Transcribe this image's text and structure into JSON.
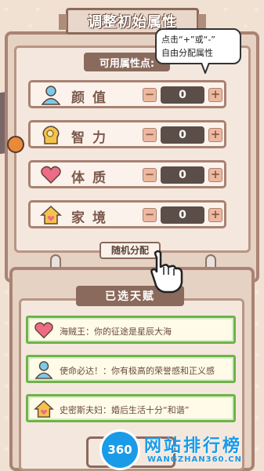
{
  "title": "调整初始属性",
  "available_points_label": "可用属性点:",
  "tooltip": {
    "line1": "点击“+”或“-”",
    "line2": "自由分配属性"
  },
  "attributes": [
    {
      "label": "颜值",
      "icon": "person-icon",
      "value": "0"
    },
    {
      "label": "智力",
      "icon": "brain-icon",
      "value": "0"
    },
    {
      "label": "体质",
      "icon": "heart-icon",
      "value": "0"
    },
    {
      "label": "家境",
      "icon": "house-icon",
      "value": "0"
    }
  ],
  "controls": {
    "minus": "−",
    "plus": "+"
  },
  "random_button": "随机分配",
  "selected_talents_label": "已选天赋",
  "talents": [
    {
      "icon": "heart-icon",
      "text": "海贼王：你的征途是星辰大海"
    },
    {
      "icon": "person-icon",
      "text": "使命必达！：你有极高的荣誉感和正义感"
    },
    {
      "icon": "house-icon",
      "text": "史密斯夫妇：婚后生活十分“和谐”"
    }
  ],
  "confirm_button": "定",
  "watermark": {
    "badge": "360",
    "title": "网站排行榜",
    "subtitle": "WANGZHAN360.CN"
  },
  "colors": {
    "panel_border": "#a98374",
    "accent_green": "#6fb34a",
    "value_bg": "#5b4e48"
  }
}
